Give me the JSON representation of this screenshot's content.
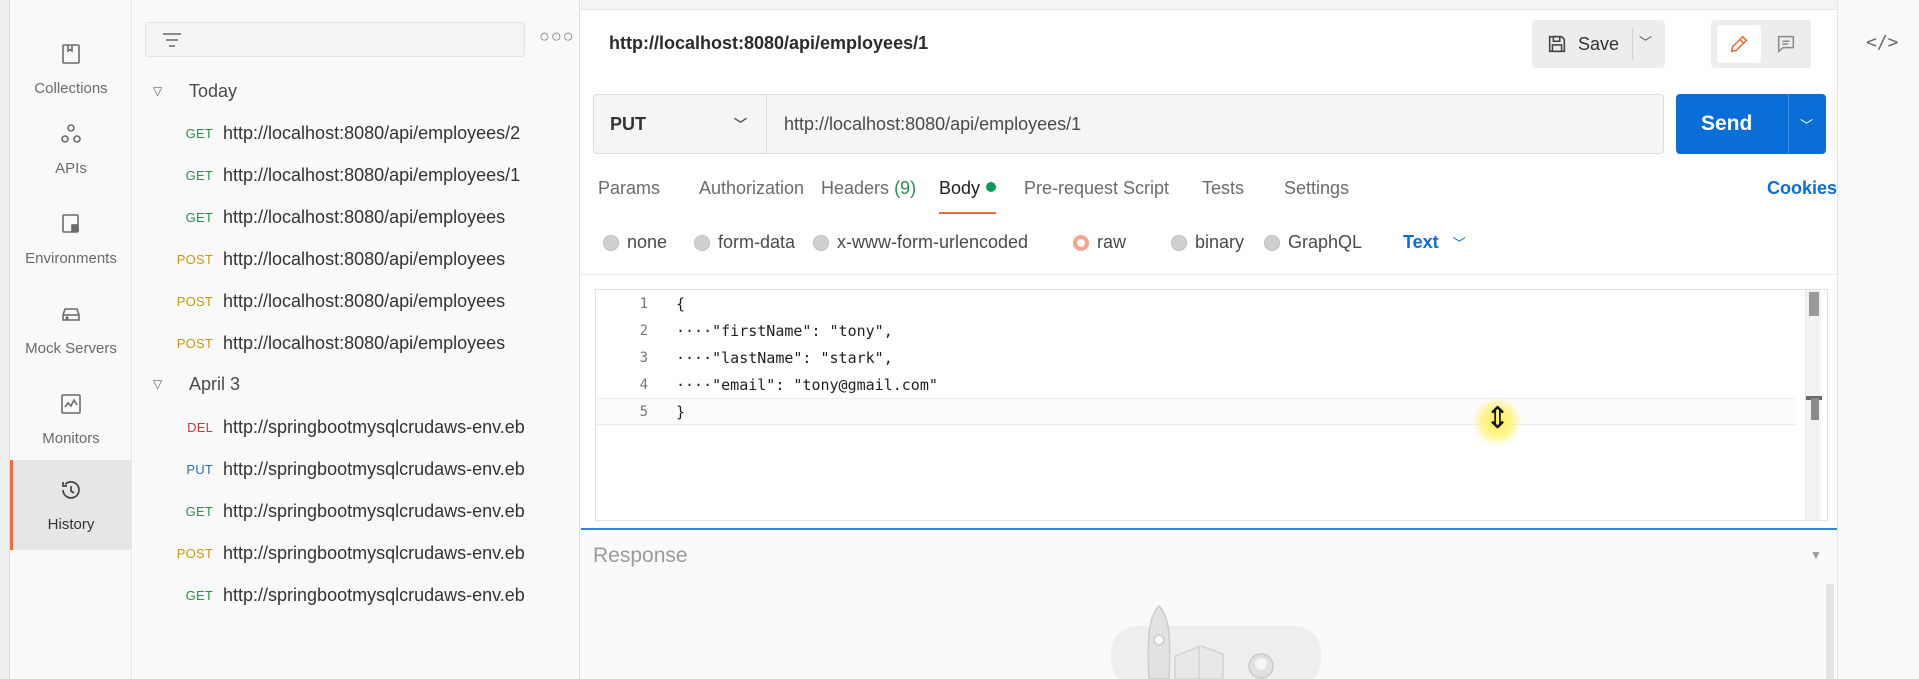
{
  "rail": {
    "items": [
      {
        "label": "Collections",
        "icon": "collections-icon",
        "active": false
      },
      {
        "label": "APIs",
        "icon": "apis-icon",
        "active": false
      },
      {
        "label": "Environments",
        "icon": "environments-icon",
        "active": false
      },
      {
        "label": "Mock Servers",
        "icon": "mock-servers-icon",
        "active": false
      },
      {
        "label": "Monitors",
        "icon": "monitors-icon",
        "active": false
      },
      {
        "label": "History",
        "icon": "history-icon",
        "active": true
      }
    ]
  },
  "sidebar": {
    "groups": [
      {
        "label": "Today"
      },
      {
        "label": "April 3"
      }
    ],
    "items": [
      {
        "method": "GET",
        "url": "http://localhost:8080/api/employees/2"
      },
      {
        "method": "GET",
        "url": "http://localhost:8080/api/employees/1"
      },
      {
        "method": "GET",
        "url": "http://localhost:8080/api/employees"
      },
      {
        "method": "POST",
        "url": "http://localhost:8080/api/employees"
      },
      {
        "method": "POST",
        "url": "http://localhost:8080/api/employees"
      },
      {
        "method": "POST",
        "url": "http://localhost:8080/api/employees"
      },
      {
        "method": "DEL",
        "url": "http://springbootmysqlcrudaws-env.eb"
      },
      {
        "method": "PUT",
        "url": "http://springbootmysqlcrudaws-env.eb"
      },
      {
        "method": "GET",
        "url": "http://springbootmysqlcrudaws-env.eb"
      },
      {
        "method": "POST",
        "url": "http://springbootmysqlcrudaws-env.eb"
      },
      {
        "method": "GET",
        "url": "http://springbootmysqlcrudaws-env.eb"
      }
    ]
  },
  "request": {
    "title": "http://localhost:8080/api/employees/1",
    "save_label": "Save",
    "method": "PUT",
    "url": "http://localhost:8080/api/employees/1",
    "send_label": "Send"
  },
  "tabs": {
    "params": "Params",
    "authorization": "Authorization",
    "headers": "Headers",
    "headers_count": "(9)",
    "body": "Body",
    "prerequest": "Pre-request Script",
    "tests": "Tests",
    "settings": "Settings",
    "cookies": "Cookies"
  },
  "body_options": {
    "none": "none",
    "form_data": "form-data",
    "urlencoded": "x-www-form-urlencoded",
    "raw": "raw",
    "binary": "binary",
    "graphql": "GraphQL",
    "selected": "raw",
    "format": "Text"
  },
  "editor": {
    "lines": [
      {
        "n": "1",
        "code": "{"
      },
      {
        "n": "2",
        "code": "····\"firstName\": \"tony\","
      },
      {
        "n": "3",
        "code": "····\"lastName\": \"stark\","
      },
      {
        "n": "4",
        "code": "····\"email\": \"tony@gmail.com\""
      },
      {
        "n": "5",
        "code": "}"
      }
    ]
  },
  "response": {
    "label": "Response"
  },
  "colors": {
    "accent": "#f26b3a",
    "send_blue": "#0a6ed9",
    "get": "#2a8f4a",
    "post": "#c89a10",
    "delete": "#c43b3b",
    "put": "#2a6fa8"
  }
}
